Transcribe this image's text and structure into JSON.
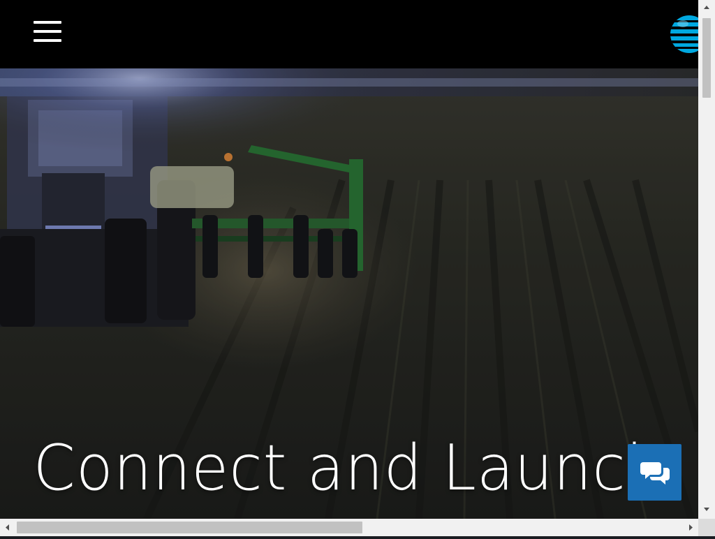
{
  "header": {
    "menu_icon": "hamburger-menu-icon",
    "logo_icon": "att-globe-logo-icon",
    "logo_color": "#00a8e0",
    "background": "#000000"
  },
  "hero": {
    "title": "Connect and Launch",
    "background_image": "tractor planting in a field at dusk"
  },
  "chat": {
    "icon": "chat-bubbles-icon",
    "color": "#1b6fb5"
  },
  "scrollbars": {
    "vertical": "vertical-scrollbar",
    "horizontal": "horizontal-scrollbar"
  }
}
